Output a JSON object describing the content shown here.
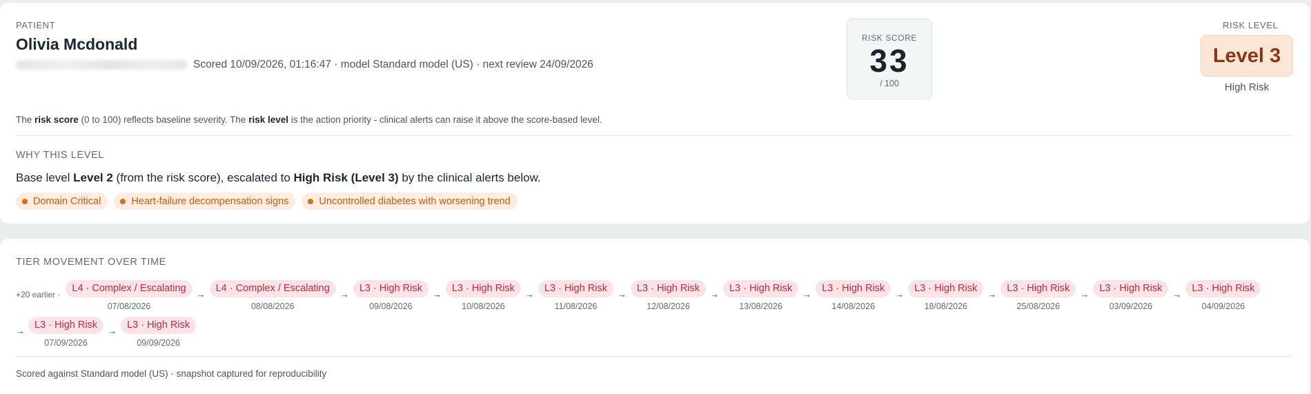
{
  "patient": {
    "label": "PATIENT",
    "name": "Olivia Mcdonald",
    "meta": "Scored 10/09/2026, 01:16:47 · model Standard model (US) · next review 24/09/2026"
  },
  "risk_score": {
    "label": "RISK SCORE",
    "value": "33",
    "max": "/ 100"
  },
  "risk_level": {
    "label": "RISK LEVEL",
    "badge": "Level 3",
    "name": "High Risk"
  },
  "explanation": {
    "p1": "The ",
    "b1": "risk score",
    "p2": " (0 to 100) reflects baseline severity. The ",
    "b2": "risk level",
    "p3": " is the action priority - clinical alerts can raise it above the score-based level."
  },
  "why": {
    "label": "WHY THIS LEVEL",
    "t1": "Base level ",
    "b1": "Level 2",
    "t2": " (from the risk score), escalated to ",
    "b2": "High Risk (Level 3)",
    "t3": " by the clinical alerts below.",
    "alerts": [
      "Domain Critical",
      "Heart-failure decompensation signs",
      "Uncontrolled diabetes with worsening trend"
    ]
  },
  "tier_movement": {
    "label": "TIER MOVEMENT OVER TIME",
    "earlier": "+20 earlier ·",
    "arrow": "→",
    "steps": [
      {
        "tier": "L4 · Complex / Escalating",
        "date": "07/08/2026"
      },
      {
        "tier": "L4 · Complex / Escalating",
        "date": "08/08/2026"
      },
      {
        "tier": "L3 · High Risk",
        "date": "09/08/2026"
      },
      {
        "tier": "L3 · High Risk",
        "date": "10/08/2026"
      },
      {
        "tier": "L3 · High Risk",
        "date": "11/08/2026"
      },
      {
        "tier": "L3 · High Risk",
        "date": "12/08/2026"
      },
      {
        "tier": "L3 · High Risk",
        "date": "13/08/2026"
      },
      {
        "tier": "L3 · High Risk",
        "date": "14/08/2026"
      },
      {
        "tier": "L3 · High Risk",
        "date": "18/08/2026"
      },
      {
        "tier": "L3 · High Risk",
        "date": "25/08/2026"
      },
      {
        "tier": "L3 · High Risk",
        "date": "03/09/2026"
      },
      {
        "tier": "L3 · High Risk",
        "date": "04/09/2026"
      },
      {
        "tier": "L3 · High Risk",
        "date": "07/09/2026"
      },
      {
        "tier": "L3 · High Risk",
        "date": "09/09/2026"
      }
    ]
  },
  "footer": "Scored against Standard model (US) · snapshot captured for reproducibility"
}
